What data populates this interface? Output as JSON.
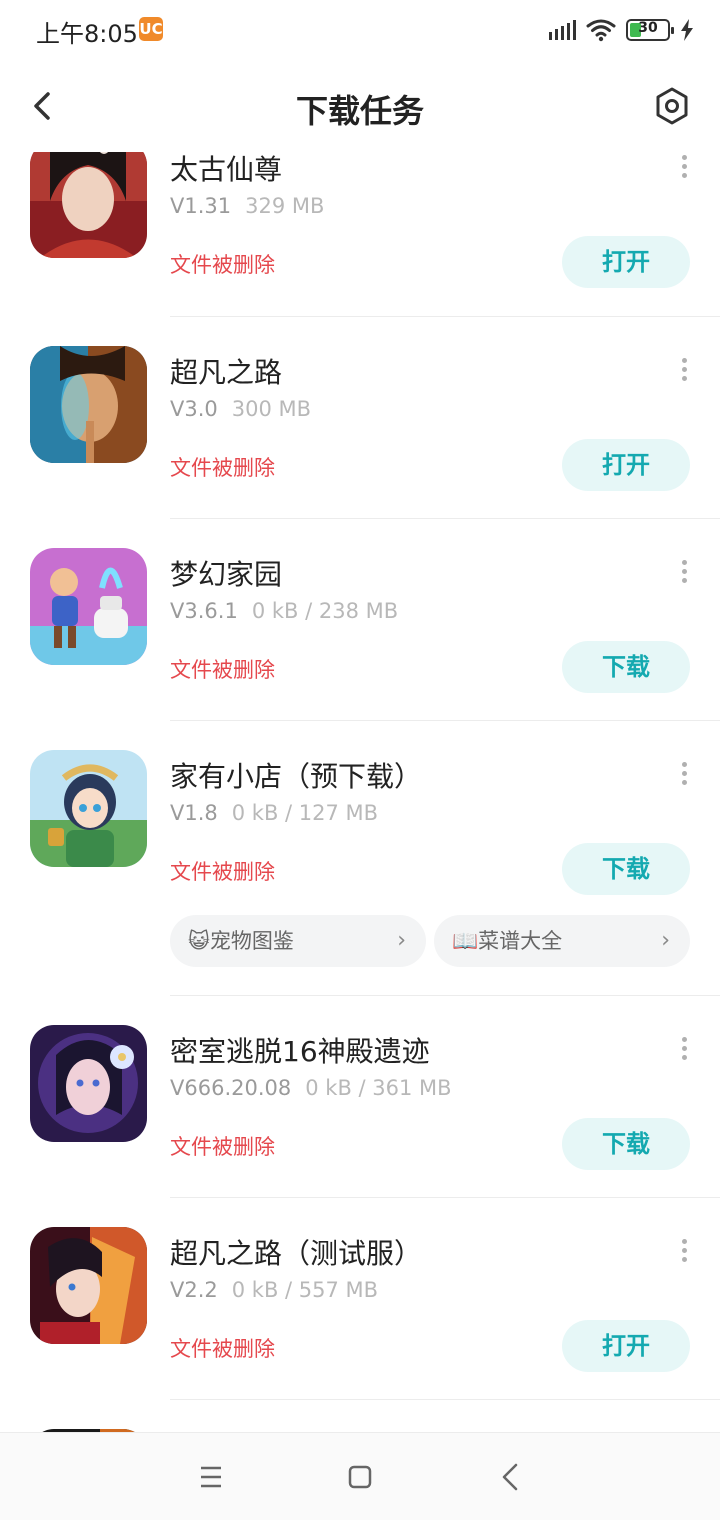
{
  "status_bar": {
    "time": "上午8:05",
    "app_icon_glyph": "UC",
    "battery_level": "30",
    "battery_fraction": 0.3
  },
  "header": {
    "title": "下载任务",
    "back_icon": "chevron-left-icon",
    "settings_icon": "settings-hexagon-icon"
  },
  "colors": {
    "accent": "#14a9b0",
    "button_bg": "#e6f7f7",
    "status_red": "#e5484d",
    "meta_gray": "#9a9a9a"
  },
  "items": [
    {
      "name": "太古仙尊",
      "version": "V1.31",
      "size": "329 MB",
      "status": "文件被删除",
      "action": "打开"
    },
    {
      "name": "超凡之路",
      "version": "V3.0",
      "size": "300 MB",
      "status": "文件被删除",
      "action": "打开"
    },
    {
      "name": "梦幻家园",
      "version": "V3.6.1",
      "size": "0 kB / 238 MB",
      "status": "文件被删除",
      "action": "下载"
    },
    {
      "name": "家有小店（预下载）",
      "version": "V1.8",
      "size": "0 kB / 127 MB",
      "status": "文件被删除",
      "action": "下载",
      "chips": [
        {
          "label": "😺宠物图鉴"
        },
        {
          "label": "📖菜谱大全"
        }
      ]
    },
    {
      "name": "密室逃脱16神殿遗迹",
      "version": "V666.20.08",
      "size": "0 kB / 361 MB",
      "status": "文件被删除",
      "action": "下载"
    },
    {
      "name": "超凡之路（测试服）",
      "version": "V2.2",
      "size": "0 kB / 557 MB",
      "status": "文件被删除",
      "action": "打开"
    }
  ],
  "nav_bar": {
    "menu_icon": "menu-icon",
    "home_icon": "home-square-icon",
    "back_icon": "back-triangle-icon"
  }
}
